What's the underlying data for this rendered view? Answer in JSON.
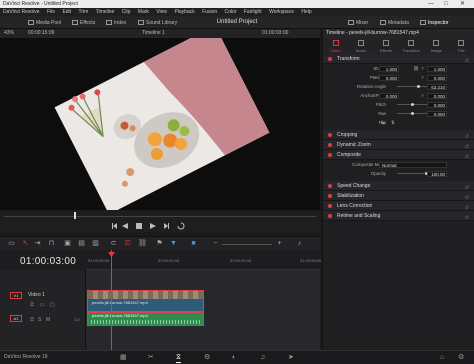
{
  "titlebar": {
    "title": "DaVinci Resolve - Untitled Project",
    "minimize": "—",
    "maximize": "□",
    "close": "✕"
  },
  "menu": [
    "DaVinci Resolve",
    "File",
    "Edit",
    "Trim",
    "Timeline",
    "Clip",
    "Mark",
    "View",
    "Playback",
    "Fusion",
    "Color",
    "Fairlight",
    "Workspace",
    "Help"
  ],
  "toolbar": {
    "media_pool": "Media Pool",
    "effects": "Effects",
    "index": "Index",
    "sound_library": "Sound Library",
    "project_title": "Untitled Project",
    "mixer": "Mixer",
    "metadata": "Metadata",
    "inspector": "Inspector"
  },
  "viewer": {
    "zoom": "43%",
    "source_tc": "00:00:15:09",
    "timeline_name": "Timeline 1",
    "record_tc": "01:00:03:00"
  },
  "timeline": {
    "current_tc": "01:00:03:00",
    "ruler": [
      "01:00:00:00",
      "01:00:02:00",
      "01:00:04:00",
      "01:00:06:00",
      "01:00:08:00"
    ],
    "video_track": {
      "id": "V1",
      "name": "Video 1",
      "clip": "pexels-jill-burrow-7681547.mp4"
    },
    "audio_track": {
      "id": "A1",
      "level": "1.0",
      "clip": "pexels-jill-burrow-7681547.mp4"
    }
  },
  "inspector": {
    "header": "Timeline - pexels-jill-burrow-7681547.mp4",
    "tabs": [
      "Video",
      "Audio",
      "Effects",
      "Transition",
      "Image",
      "File"
    ],
    "active_tab": "Video",
    "transform": {
      "title": "Transform",
      "zoom_label": "Zoom",
      "zoom_x": "1.000",
      "zoom_y": "1.000",
      "position_label": "Position",
      "pos_x": "0.000",
      "pos_y": "0.000",
      "rotation_label": "Rotation Angle",
      "rotation": "63.210",
      "anchor_label": "Anchor Point",
      "anchor_x": "0.000",
      "anchor_y": "0.000",
      "pitch_label": "Pitch",
      "pitch": "0.000",
      "yaw_label": "Yaw",
      "yaw": "0.000",
      "flip_label": "Flip"
    },
    "cropping": "Cropping",
    "dynamic_zoom": "Dynamic Zoom",
    "composite": {
      "title": "Composite",
      "mode_label": "Composite Mode",
      "mode": "Normal",
      "opacity_label": "Opacity",
      "opacity": "100.00"
    },
    "speed_change": "Speed Change",
    "stabilization": "Stabilization",
    "lens_correction": "Lens Correction",
    "retime_scaling": "Retime and Scaling"
  },
  "pagebar": {
    "app": "DaVinci Resolve 18"
  },
  "colors": {
    "accent": "#e23a3a",
    "video_clip": "#2f5a7a",
    "audio_clip": "#2f8a4e"
  }
}
